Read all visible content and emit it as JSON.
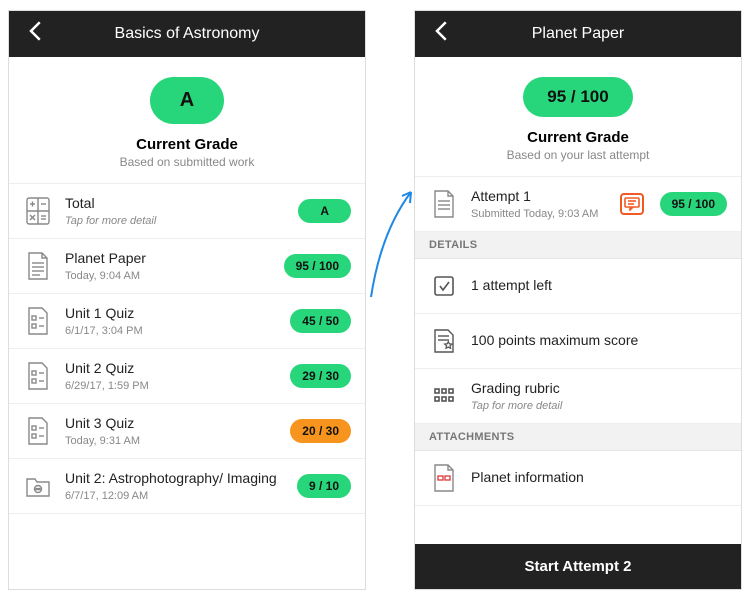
{
  "colors": {
    "accent": "#27d67a",
    "warn": "#f7941d",
    "highlight": "#f15a24",
    "header": "#222222"
  },
  "left": {
    "title": "Basics of Astronomy",
    "grade_pill": "A",
    "current_grade_label": "Current Grade",
    "current_grade_sub": "Based on submitted work",
    "items": [
      {
        "icon": "calculator-icon",
        "title": "Total",
        "sub": "Tap for more detail",
        "pill": "A",
        "pill_style": "wide"
      },
      {
        "icon": "document-icon",
        "title": "Planet Paper",
        "sub": "Today, 9:04 AM",
        "pill": "95 / 100"
      },
      {
        "icon": "test-icon",
        "title": "Unit 1 Quiz",
        "sub": "6/1/17, 3:04 PM",
        "pill": "45 / 50"
      },
      {
        "icon": "test-icon",
        "title": "Unit 2 Quiz",
        "sub": "6/29/17, 1:59 PM",
        "pill": "29 / 30"
      },
      {
        "icon": "test-icon",
        "title": "Unit 3 Quiz",
        "sub": "Today, 9:31 AM",
        "pill": "20 / 30",
        "pill_style": "orange"
      },
      {
        "icon": "folder-discussion-icon",
        "title": "Unit 2: Astrophotography/ Imaging",
        "sub": "6/7/17, 12:09 AM",
        "pill": "9 / 10"
      }
    ]
  },
  "right": {
    "title": "Planet Paper",
    "grade_pill": "95 / 100",
    "current_grade_label": "Current Grade",
    "current_grade_sub": "Based on your last attempt",
    "attempt": {
      "title": "Attempt 1",
      "sub": "Submitted Today, 9:03 AM",
      "pill": "95 / 100"
    },
    "details_label": "DETAILS",
    "details": [
      {
        "icon": "checkbox-icon",
        "text": "1 attempt left"
      },
      {
        "icon": "points-icon",
        "text": "100 points maximum score"
      },
      {
        "icon": "rubric-icon",
        "text": "Grading rubric",
        "sub": "Tap for more detail"
      }
    ],
    "attachments_label": "ATTACHMENTS",
    "attachments": [
      {
        "icon": "attachment-doc-icon",
        "text": "Planet information"
      }
    ],
    "footer_button": "Start Attempt 2"
  }
}
